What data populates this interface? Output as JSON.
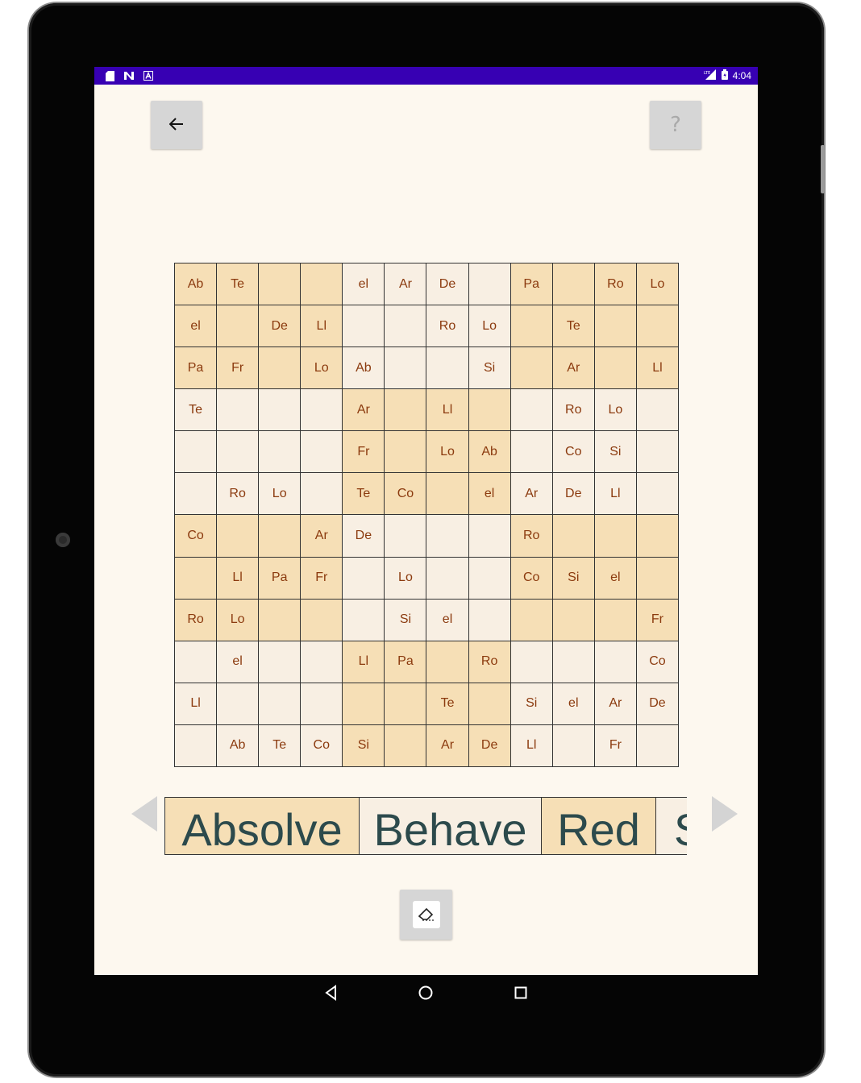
{
  "status_bar": {
    "time": "4:04",
    "left_icons": [
      "sd-card-icon",
      "n-icon",
      "a-icon"
    ],
    "right_icons": [
      "lte-signal-icon",
      "battery-icon"
    ]
  },
  "toolbar": {
    "back_icon": "arrow-left-icon",
    "help_label": "?"
  },
  "grid": {
    "rows": [
      [
        "Ab",
        "Te",
        "",
        "",
        "el",
        "Ar",
        "De",
        "",
        "Pa",
        "",
        "Ro",
        "Lo"
      ],
      [
        "el",
        "",
        "De",
        "Ll",
        "",
        "",
        "Ro",
        "Lo",
        "",
        "Te",
        "",
        ""
      ],
      [
        "Pa",
        "Fr",
        "",
        "Lo",
        "Ab",
        "",
        "",
        "Si",
        "",
        "Ar",
        "",
        "Ll"
      ],
      [
        "Te",
        "",
        "",
        "",
        "Ar",
        "",
        "Ll",
        "",
        "",
        "Ro",
        "Lo",
        ""
      ],
      [
        "",
        "",
        "",
        "",
        "Fr",
        "",
        "Lo",
        "Ab",
        "",
        "Co",
        "Si",
        ""
      ],
      [
        "",
        "Ro",
        "Lo",
        "",
        "Te",
        "Co",
        "",
        "el",
        "Ar",
        "De",
        "Ll",
        ""
      ],
      [
        "Co",
        "",
        "",
        "Ar",
        "De",
        "",
        "",
        "",
        "Ro",
        "",
        "",
        ""
      ],
      [
        "",
        "Ll",
        "Pa",
        "Fr",
        "",
        "Lo",
        "",
        "",
        "Co",
        "Si",
        "el",
        ""
      ],
      [
        "Ro",
        "Lo",
        "",
        "",
        "",
        "Si",
        "el",
        "",
        "",
        "",
        "",
        "Fr"
      ],
      [
        "",
        "el",
        "",
        "",
        "Ll",
        "Pa",
        "",
        "Ro",
        "",
        "",
        "",
        "Co"
      ],
      [
        "Ll",
        "",
        "",
        "",
        "",
        "",
        "Te",
        "",
        "Si",
        "el",
        "Ar",
        "De"
      ],
      [
        "",
        "Ab",
        "Te",
        "Co",
        "Si",
        "",
        "Ar",
        "De",
        "Ll",
        "",
        "Fr",
        ""
      ]
    ],
    "colors": {
      "shaded": "#f6dfb6",
      "light": "#f8efe3",
      "text": "#8b3a0e"
    }
  },
  "words": {
    "items": [
      "Absolve",
      "Behave",
      "Red",
      "S"
    ],
    "text_color": "#2c4a4c"
  },
  "eraser": {
    "icon": "eraser-icon"
  },
  "nav": {
    "icons": [
      "nav-back-icon",
      "nav-home-icon",
      "nav-recents-icon"
    ]
  }
}
